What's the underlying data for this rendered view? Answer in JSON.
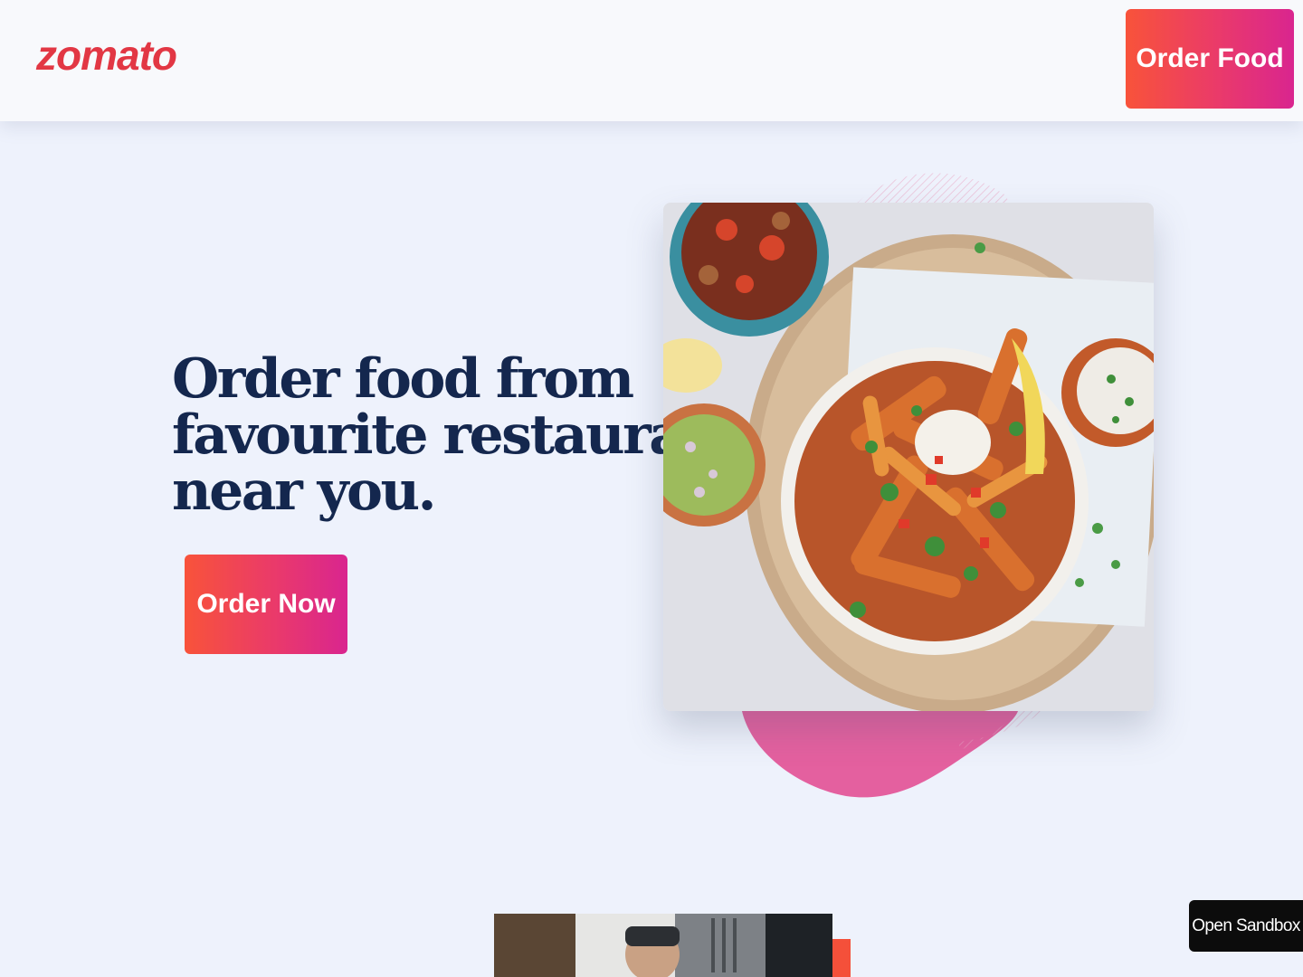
{
  "header": {
    "logo": "zomato",
    "order_food_label": "Order Food"
  },
  "hero": {
    "title_lines": [
      "Order food from",
      "favourite restaurants",
      "near you."
    ],
    "order_now_label": "Order Now"
  },
  "sandbox": {
    "label": "Open Sandbox"
  },
  "colors": {
    "brand": "#e23744",
    "heading": "#14274e",
    "background": "#eef2fc",
    "button_gradient_start": "#f8533a",
    "button_gradient_end": "#d9258f",
    "blob": "#e4609f"
  }
}
